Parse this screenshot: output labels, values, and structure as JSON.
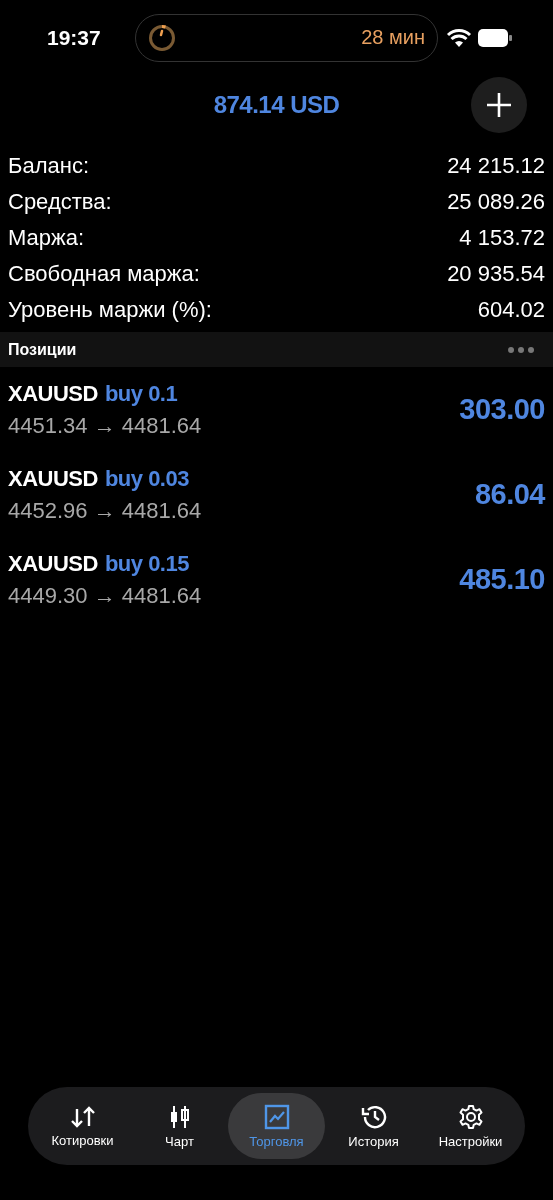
{
  "status_bar": {
    "time": "19:37",
    "activity": {
      "timer": "28 мин"
    }
  },
  "header": {
    "title": "874.14 USD"
  },
  "summary": [
    {
      "label": "Баланс:",
      "value": "24 215.12"
    },
    {
      "label": "Средства:",
      "value": "25 089.26"
    },
    {
      "label": "Маржа:",
      "value": "4 153.72"
    },
    {
      "label": "Свободная маржа:",
      "value": "20 935.54"
    },
    {
      "label": "Уровень маржи (%):",
      "value": "604.02"
    }
  ],
  "positions": {
    "title": "Позиции",
    "items": [
      {
        "symbol": "XAUUSD",
        "side": "buy 0.1",
        "prices": "4451.34 → 4481.64",
        "profit": "303.00"
      },
      {
        "symbol": "XAUUSD",
        "side": "buy 0.03",
        "prices": "4452.96 → 4481.64",
        "profit": "86.04"
      },
      {
        "symbol": "XAUUSD",
        "side": "buy 0.15",
        "prices": "4449.30 → 4481.64",
        "profit": "485.10"
      }
    ]
  },
  "tabs": [
    {
      "label": "Котировки",
      "kind": "quotes",
      "selected": false
    },
    {
      "label": "Чарт",
      "kind": "chart",
      "selected": false
    },
    {
      "label": "Торговля",
      "kind": "trade",
      "selected": true
    },
    {
      "label": "История",
      "kind": "history",
      "selected": false
    },
    {
      "label": "Настройки",
      "kind": "settings",
      "selected": false
    }
  ]
}
